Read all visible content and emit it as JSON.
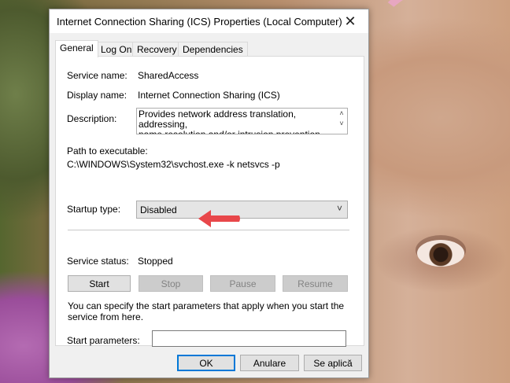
{
  "window": {
    "title": "Internet Connection Sharing (ICS) Properties (Local Computer)",
    "close_glyph": "✕"
  },
  "tabs": [
    {
      "label": "General",
      "active": true
    },
    {
      "label": "Log On",
      "active": false
    },
    {
      "label": "Recovery",
      "active": false
    },
    {
      "label": "Dependencies",
      "active": false
    }
  ],
  "general": {
    "service_name_label": "Service name:",
    "service_name": "SharedAccess",
    "display_name_label": "Display name:",
    "display_name": "Internet Connection Sharing (ICS)",
    "description_label": "Description:",
    "description": "Provides network address translation, addressing,\nname resolution and/or intrusion prevention services",
    "path_label": "Path to executable:",
    "path": "C:\\WINDOWS\\System32\\svchost.exe -k netsvcs -p",
    "startup_type_label": "Startup type:",
    "startup_type": "Disabled",
    "service_status_label": "Service status:",
    "service_status": "Stopped",
    "buttons": {
      "start": "Start",
      "stop": "Stop",
      "pause": "Pause",
      "resume": "Resume"
    },
    "note": "You can specify the start parameters that apply when you start the service from here.",
    "start_params_label": "Start parameters:",
    "start_params_value": ""
  },
  "footer": {
    "ok": "OK",
    "cancel": "Anulare",
    "apply": "Se aplică"
  },
  "colors": {
    "accent": "#0078d7",
    "arrow": "#e8474a"
  }
}
